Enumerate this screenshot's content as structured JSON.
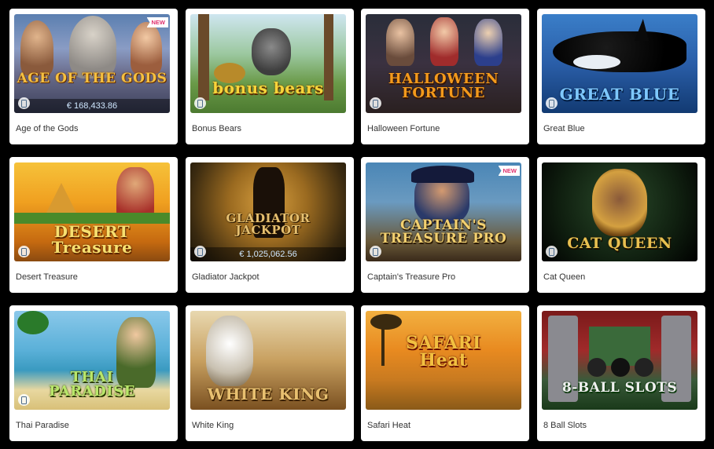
{
  "games": [
    {
      "title": "Age of the Gods",
      "logo": "AGE OF THE GODS",
      "jackpot": "€ 168,433.86",
      "new_badge": "NEW"
    },
    {
      "title": "Bonus Bears",
      "logo": "bonus bears"
    },
    {
      "title": "Halloween Fortune",
      "logo": "HALLOWEEN FORTUNE"
    },
    {
      "title": "Great Blue",
      "logo": "GREAT BLUE"
    },
    {
      "title": "Desert Treasure",
      "logo": "DESERT Treasure"
    },
    {
      "title": "Gladiator Jackpot",
      "logo": "GLADIATOR JACKPOT",
      "jackpot": "€ 1,025,062.56"
    },
    {
      "title": "Captain's Treasure Pro",
      "logo": "CAPTAIN'S TREASURE PRO",
      "new_badge": "NEW"
    },
    {
      "title": "Cat Queen",
      "logo": "CAT QUEEN"
    },
    {
      "title": "Thai Paradise",
      "logo": "THAI PARADISE"
    },
    {
      "title": "White King",
      "logo": "WHITE KING"
    },
    {
      "title": "Safari Heat",
      "logo": "SAFARI Heat"
    },
    {
      "title": "8 Ball Slots",
      "logo": "8-BALL SLOTS"
    }
  ],
  "icons": {
    "platform": "mobile-icon"
  }
}
